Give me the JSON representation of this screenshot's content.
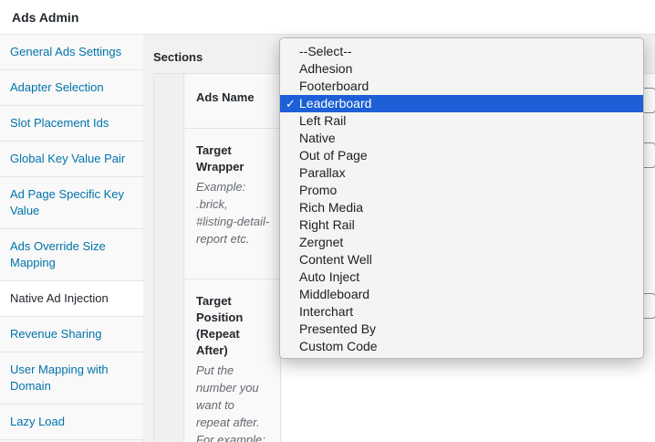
{
  "header": {
    "title": "Ads Admin"
  },
  "nav": {
    "items": [
      {
        "label": "General Ads Settings"
      },
      {
        "label": "Adapter Selection"
      },
      {
        "label": "Slot Placement Ids"
      },
      {
        "label": "Global Key Value Pair"
      },
      {
        "label": "Ad Page Specific Key Value"
      },
      {
        "label": "Ads Override Size Mapping"
      },
      {
        "label": "Native Ad Injection"
      },
      {
        "label": "Revenue Sharing"
      },
      {
        "label": "User Mapping with Domain"
      },
      {
        "label": "Lazy Load"
      }
    ],
    "active_index": 6
  },
  "main": {
    "sections_title": "Sections",
    "fields": [
      {
        "label": "Ads Name",
        "help": ""
      },
      {
        "label": "Target Wrapper",
        "help": "Example: .brick, #listing-detail-report etc."
      },
      {
        "label": "Target Position (Repeat After)",
        "help": "Put the number you want to repeat after. For example:"
      }
    ]
  },
  "dropdown": {
    "selected": "Leaderboard",
    "check_glyph": "✓",
    "options": [
      "--Select--",
      "Adhesion",
      "Footerboard",
      "Leaderboard",
      "Left Rail",
      "Native",
      "Out of Page",
      "Parallax",
      "Promo",
      "Rich Media",
      "Right Rail",
      "Zergnet",
      "Content Well",
      "Auto Inject",
      "Middleboard",
      "Interchart",
      "Presented By",
      "Custom Code"
    ]
  },
  "colors": {
    "link": "#0073aa",
    "selection": "#1d5fd6",
    "border": "#e2e4e7"
  }
}
